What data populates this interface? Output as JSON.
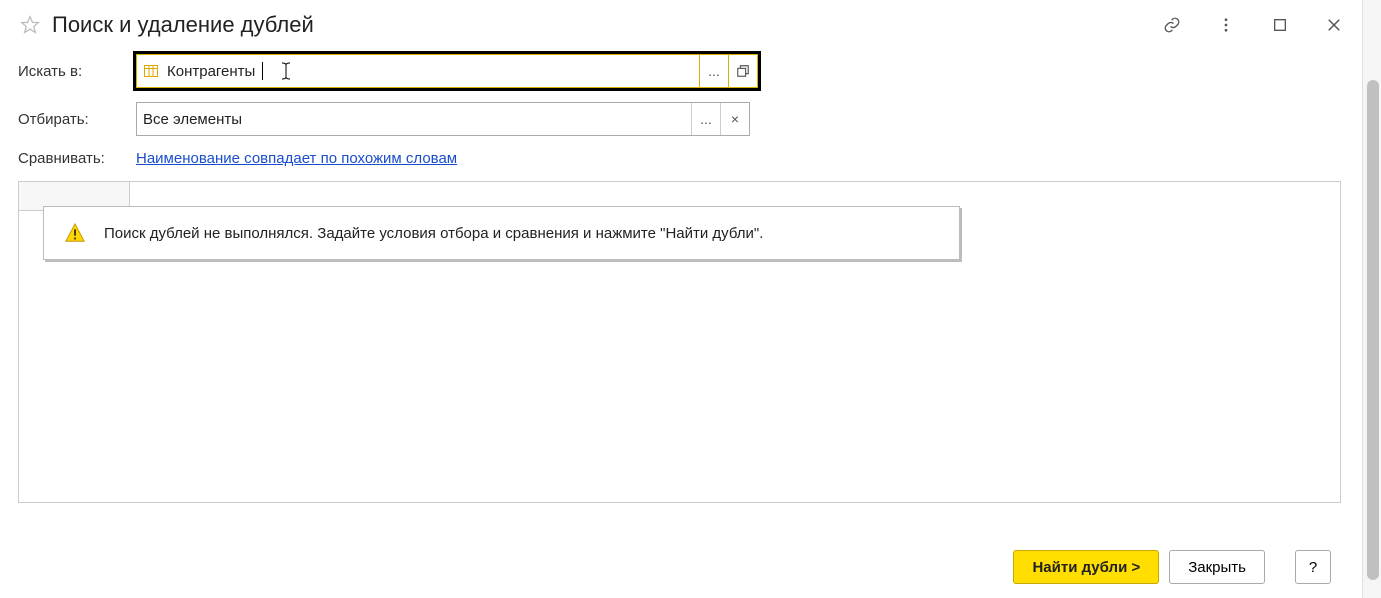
{
  "header": {
    "title": "Поиск и удаление дублей"
  },
  "form": {
    "search_in_label": "Искать в:",
    "search_in_value": "Контрагенты",
    "filter_label": "Отбирать:",
    "filter_value": "Все элементы",
    "compare_label": "Сравнивать:",
    "compare_link": "Наименование совпадает по похожим словам",
    "ellipsis": "...",
    "clear": "×"
  },
  "hint": {
    "text": "Поиск дублей не выполнялся.  Задайте условия отбора и сравнения и нажмите \"Найти дубли\"."
  },
  "footer": {
    "find": "Найти дубли >",
    "close": "Закрыть",
    "help": "?"
  }
}
